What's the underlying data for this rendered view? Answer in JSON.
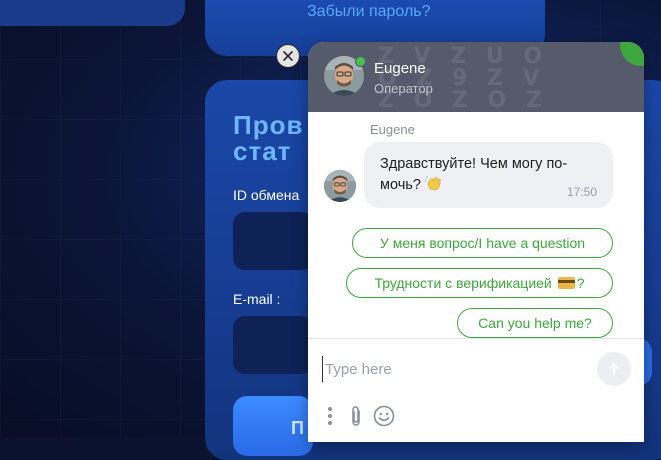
{
  "background": {
    "forgot_password_link": "Забыли пароль?",
    "form_title": "Пров\nстат",
    "id_label": "ID обмена",
    "email_label": "E-mail :",
    "submit_label": "П"
  },
  "chat": {
    "operator": {
      "name": "Eugene",
      "role": "Оператор"
    },
    "messages": [
      {
        "sender": "Eugene",
        "text": "Здравствуйте! Чем могу по-мочь?",
        "time": "17:50"
      }
    ],
    "quick_replies": [
      {
        "label": "У меня вопрос/I have a question"
      },
      {
        "label": "Трудности с верификацией",
        "suffix": "?"
      },
      {
        "label": "Can you help me?"
      }
    ],
    "input": {
      "placeholder": "Type here",
      "value": ""
    },
    "colors": {
      "accent": "#3ea63e",
      "header": "#565b6c",
      "bubble": "#eef0f4"
    }
  }
}
